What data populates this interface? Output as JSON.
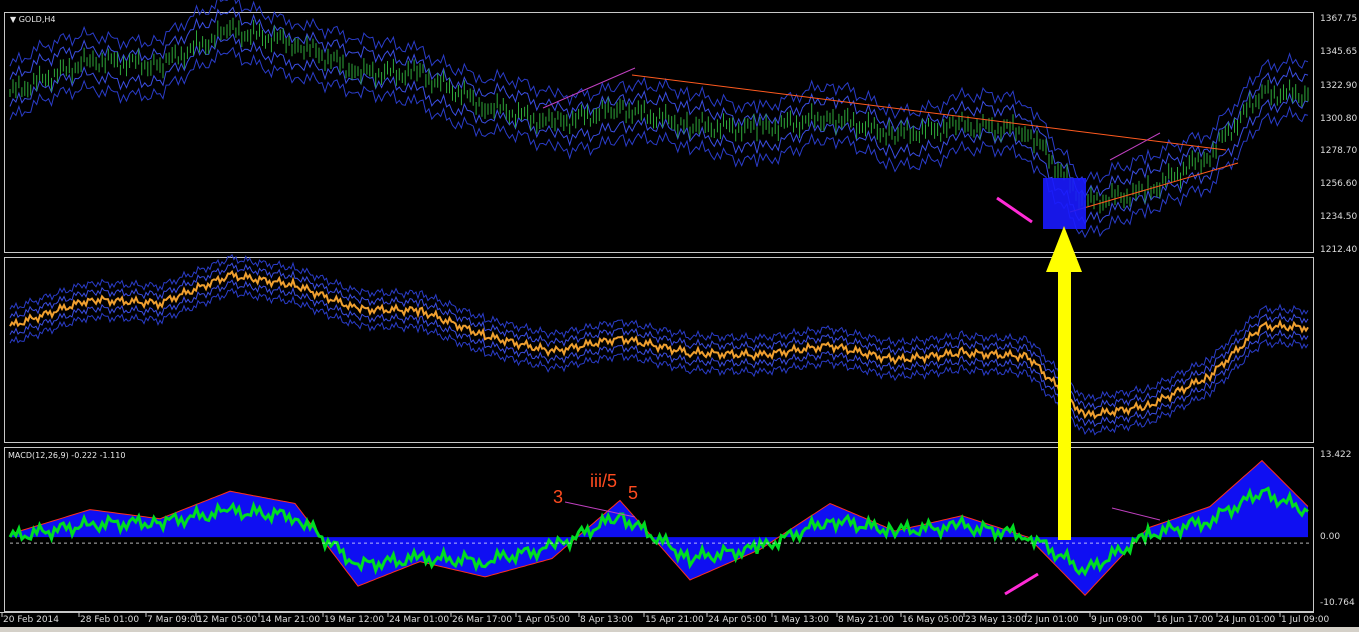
{
  "window": {
    "main_title": "GOLD,H4",
    "macd_title": "MACD(12,26,9) -0.222 -1.110"
  },
  "colors": {
    "background": "#000000",
    "bars": "#2fa83a",
    "bands": "#3a4de0",
    "price_line": "#f0a030",
    "macd_fill": "#1010ff",
    "macd_signal": "#00dd22",
    "trendline": "#ff5a1f",
    "annotation_magenta": "#ff2bd6",
    "highlight_box": "#1a1aff",
    "arrow": "#ffff00"
  },
  "chart_data": [
    {
      "type": "line",
      "title": "GOLD,H4",
      "symbol": "GOLD",
      "timeframe": "H4",
      "ylim": [
        1212.4,
        1367.75
      ],
      "yticks": [
        "1367.75",
        "1345.65",
        "1322.90",
        "1300.80",
        "1278.70",
        "1256.60",
        "1234.50",
        "1212.40"
      ],
      "x": [
        "20 Feb 2014",
        "28 Feb 01:00",
        "7 Mar 09:00",
        "12 Mar 05:00",
        "14 Mar 21:00",
        "19 Mar 12:00",
        "24 Mar 01:00",
        "26 Mar 17:00",
        "1 Apr 05:00",
        "8 Apr 13:00",
        "15 Apr 21:00",
        "24 Apr 05:00",
        "1 May 13:00",
        "8 May 21:00",
        "16 May 05:00",
        "23 May 13:00",
        "2 Jun 01:00",
        "9 Jun 09:00",
        "16 Jun 17:00",
        "24 Jun 01:00",
        "1 Jul 09:00"
      ],
      "series": [
        {
          "values": [
            1318,
            1340,
            1337,
            1360,
            1352,
            1332,
            1331,
            1310,
            1297,
            1308,
            1296,
            1294,
            1302,
            1290,
            1296,
            1293,
            1244,
            1252,
            1277,
            1318,
            1317
          ]
        }
      ],
      "annotations": [
        "descending trendline",
        "highlight box near 2 Jun 01:00",
        "yellow arrow"
      ]
    },
    {
      "type": "line",
      "title": "",
      "series": [
        {
          "values": [
            1318,
            1340,
            1337,
            1360,
            1352,
            1332,
            1331,
            1310,
            1297,
            1308,
            1296,
            1294,
            1302,
            1290,
            1296,
            1293,
            1244,
            1252,
            1277,
            1318,
            1317
          ]
        }
      ]
    },
    {
      "type": "area",
      "title": "MACD(12,26,9) -0.222 -1.110",
      "ylim": [
        -10.764,
        13.422
      ],
      "yticks": [
        "13.422",
        "0.00",
        "-10.764"
      ],
      "series": [
        {
          "name": "MACD",
          "values": [
            0.5,
            4.5,
            3.0,
            7.5,
            5.5,
            -8.0,
            -4.0,
            -6.5,
            -3.5,
            6.0,
            -7.0,
            -2.0,
            5.5,
            1.0,
            3.5,
            0.0,
            -9.5,
            1.5,
            5.0,
            12.5,
            5.0
          ]
        },
        {
          "name": "Signal",
          "values": [
            0.0,
            3.0,
            3.5,
            6.0,
            5.0,
            -6.5,
            -5.0,
            -5.5,
            -2.5,
            5.0,
            -5.0,
            -2.5,
            4.0,
            1.5,
            2.5,
            0.5,
            -8.0,
            0.5,
            4.0,
            10.5,
            6.0
          ]
        }
      ],
      "annotations": [
        "3",
        "iii/5",
        "5"
      ]
    }
  ]
}
